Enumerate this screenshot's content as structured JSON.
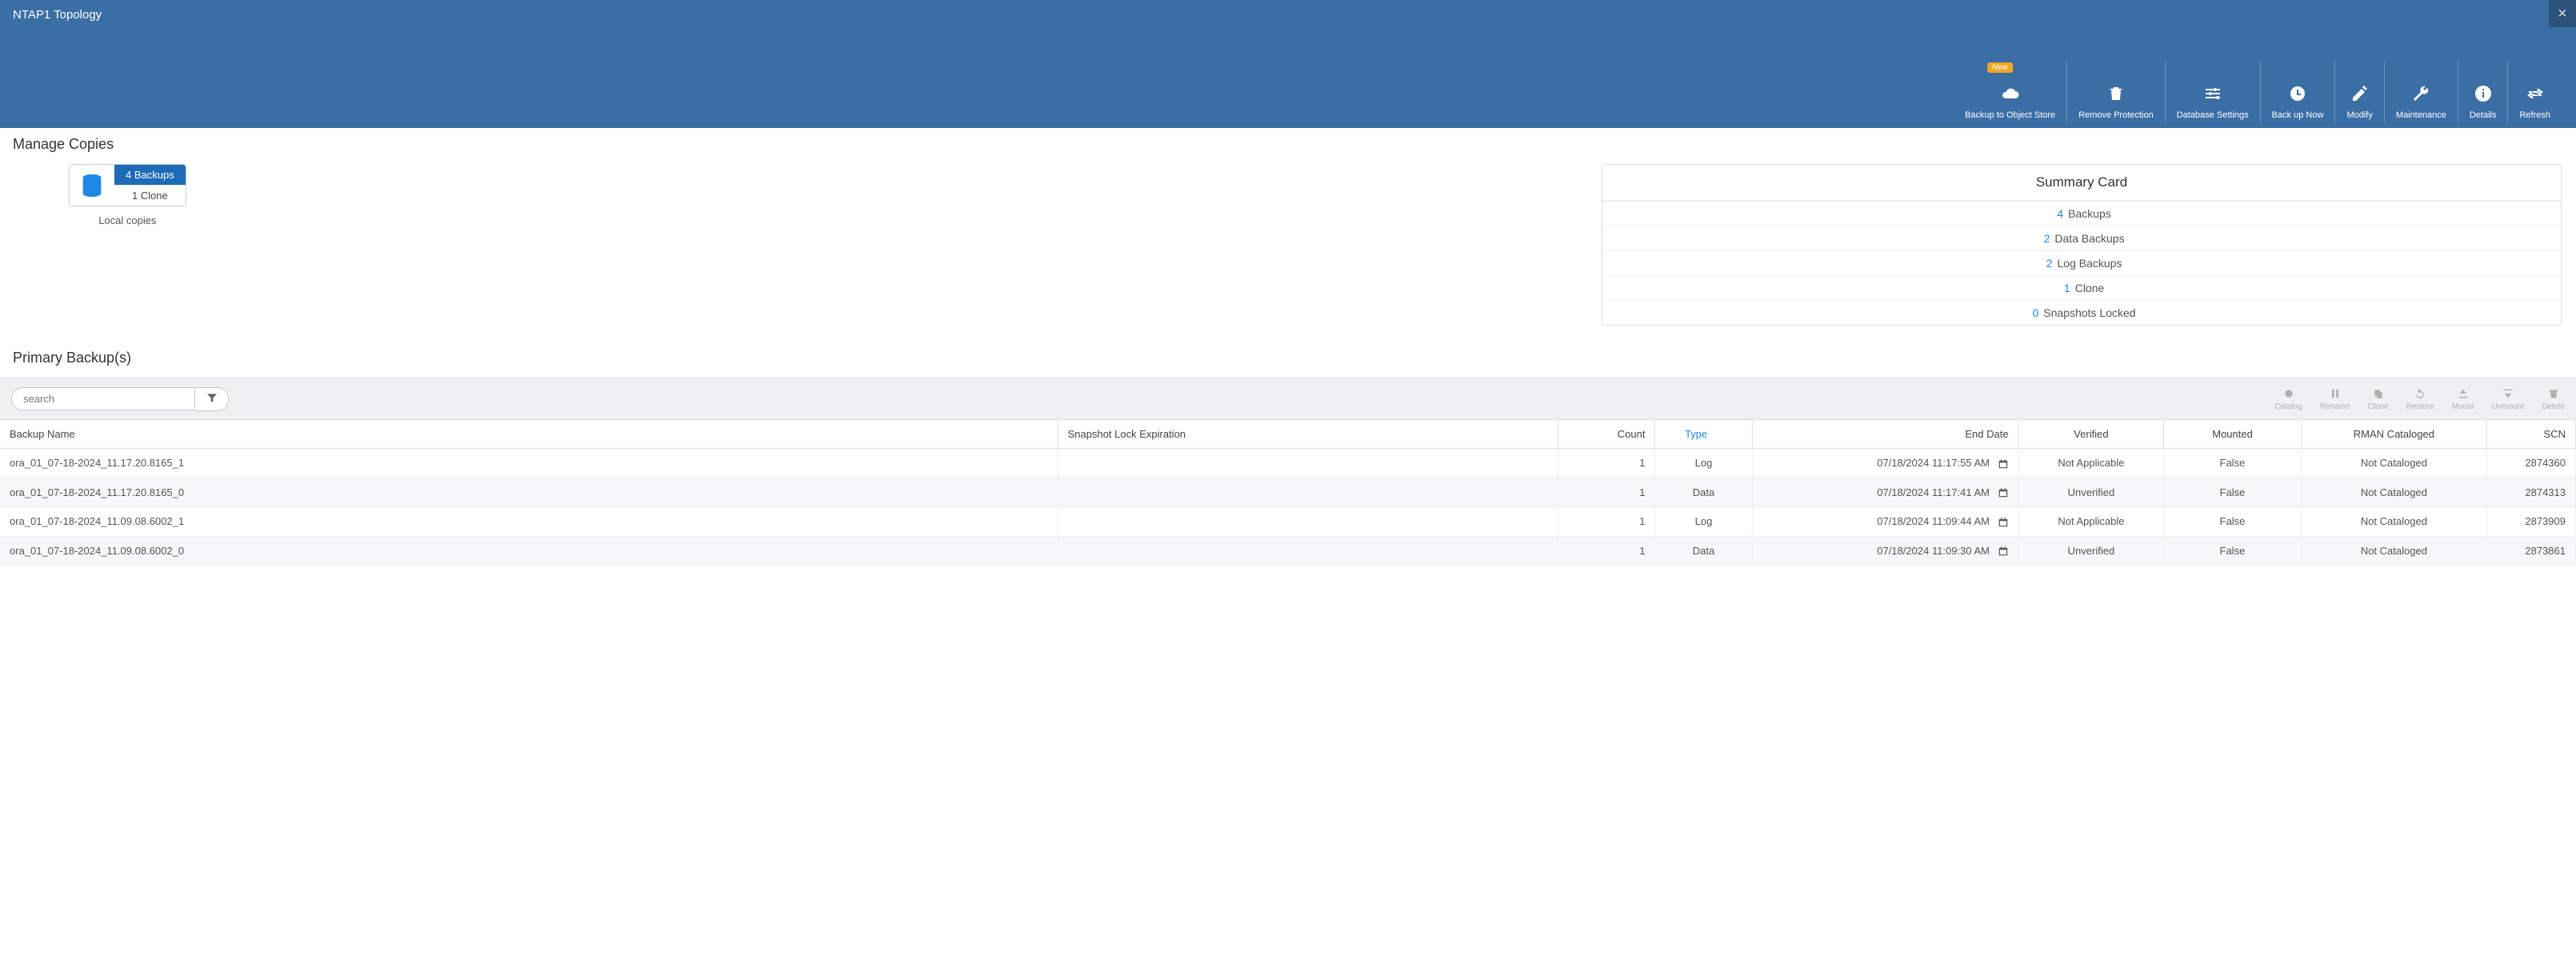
{
  "header": {
    "title": "NTAP1 Topology",
    "close_label": "×",
    "new_badge": "New",
    "toolbar": [
      {
        "key": "backup-object-store",
        "label": "Backup to Object Store"
      },
      {
        "key": "remove-protection",
        "label": "Remove Protection"
      },
      {
        "key": "database-settings",
        "label": "Database Settings"
      },
      {
        "key": "backup-now",
        "label": "Back up Now"
      },
      {
        "key": "modify",
        "label": "Modify"
      },
      {
        "key": "maintenance",
        "label": "Maintenance"
      },
      {
        "key": "details",
        "label": "Details"
      },
      {
        "key": "refresh",
        "label": "Refresh"
      }
    ]
  },
  "manage_copies": {
    "title": "Manage Copies",
    "local_label": "Local copies",
    "backups_chip": "4 Backups",
    "clones_chip": "1 Clone"
  },
  "summary_card": {
    "title": "Summary Card",
    "rows": [
      {
        "num": "4",
        "text": "Backups"
      },
      {
        "num": "2",
        "text": "Data Backups"
      },
      {
        "num": "2",
        "text": "Log Backups"
      },
      {
        "num": "1",
        "text": "Clone"
      },
      {
        "num": "0",
        "text": "Snapshots Locked"
      }
    ]
  },
  "primary_backups": {
    "title": "Primary Backup(s)",
    "search_placeholder": "search",
    "columns": {
      "backup_name": "Backup Name",
      "snapshot_lock": "Snapshot Lock Expiration",
      "count": "Count",
      "type": "Type",
      "end_date": "End Date",
      "verified": "Verified",
      "mounted": "Mounted",
      "rman": "RMAN Cataloged",
      "scn": "SCN"
    },
    "rows": [
      {
        "backup_name": "ora_01_07-18-2024_11.17.20.8165_1",
        "snapshot_lock": "",
        "count": "1",
        "type": "Log",
        "end_date": "07/18/2024 11:17:55 AM",
        "verified": "Not Applicable",
        "mounted": "False",
        "rman": "Not Cataloged",
        "scn": "2874360"
      },
      {
        "backup_name": "ora_01_07-18-2024_11.17.20.8165_0",
        "snapshot_lock": "",
        "count": "1",
        "type": "Data",
        "end_date": "07/18/2024 11:17:41 AM",
        "verified": "Unverified",
        "mounted": "False",
        "rman": "Not Cataloged",
        "scn": "2874313"
      },
      {
        "backup_name": "ora_01_07-18-2024_11.09.08.6002_1",
        "snapshot_lock": "",
        "count": "1",
        "type": "Log",
        "end_date": "07/18/2024 11:09:44 AM",
        "verified": "Not Applicable",
        "mounted": "False",
        "rman": "Not Cataloged",
        "scn": "2873909"
      },
      {
        "backup_name": "ora_01_07-18-2024_11.09.08.6002_0",
        "snapshot_lock": "",
        "count": "1",
        "type": "Data",
        "end_date": "07/18/2024 11:09:30 AM",
        "verified": "Unverified",
        "mounted": "False",
        "rman": "Not Cataloged",
        "scn": "2873861"
      }
    ],
    "actions": [
      {
        "key": "catalog",
        "label": "Catalog"
      },
      {
        "key": "rename",
        "label": "Rename"
      },
      {
        "key": "clone",
        "label": "Clone"
      },
      {
        "key": "restore",
        "label": "Restore"
      },
      {
        "key": "mount",
        "label": "Mount"
      },
      {
        "key": "unmount",
        "label": "Unmount"
      },
      {
        "key": "delete",
        "label": "Delete"
      }
    ]
  }
}
